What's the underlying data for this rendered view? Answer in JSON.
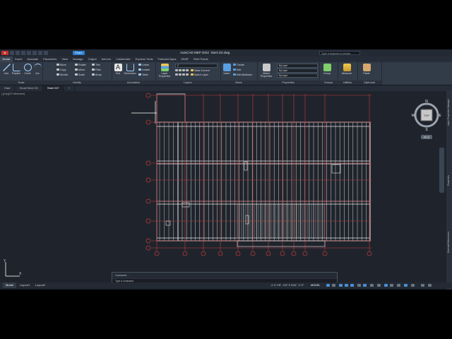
{
  "app": {
    "logo": "A",
    "title": "AutoCAD MEP 2022",
    "file": "Steel 2D.dwg",
    "share": "Share",
    "search_placeholder": "Type a keyword or phrase"
  },
  "ribbon_tabs": [
    "Home",
    "Insert",
    "Annotate",
    "Parametric",
    "View",
    "Manage",
    "Output",
    "Add-ins",
    "Collaborate",
    "Express Tools",
    "Featured Apps",
    "HMI®",
    "Field Points"
  ],
  "ribbon": {
    "draw": {
      "title": "Draw",
      "line": "Line",
      "polyline": "Polyline",
      "circle": "Circle",
      "arc": "Arc"
    },
    "modify": {
      "title": "Modify",
      "move": "Move",
      "rotate": "Rotate",
      "trim": "Trim",
      "copy": "Copy",
      "mirror": "Mirror",
      "fillet": "Fillet",
      "stretch": "Stretch",
      "scale": "Scale",
      "array": "Array"
    },
    "annotation": {
      "title": "Annotation",
      "text": "Text",
      "dimension": "Dimension",
      "linear": "Linear",
      "leader": "Leader",
      "table": "Table"
    },
    "layers": {
      "title": "Layers",
      "layer_properties": "Layer Properties",
      "layer_value": "0",
      "make_current": "Make Current",
      "match_layer": "Match Layer"
    },
    "block": {
      "title": "Block",
      "insert": "Insert",
      "create": "Create",
      "edit": "Edit",
      "edit_attributes": "Edit Attributes"
    },
    "properties": {
      "title": "Properties",
      "match_properties": "Match Properties",
      "bylayer": "ByLayer",
      "bylayer2": "ByLayer",
      "bylayer3": "ByLayer"
    },
    "groups": {
      "title": "Groups",
      "group": "Group"
    },
    "utilities": {
      "title": "Utilities",
      "measure": "Measure"
    },
    "clipboard": {
      "title": "Clipboard",
      "paste": "Paste"
    }
  },
  "file_tabs": [
    "Start",
    "Small Steel 2D",
    "Steel 2D*"
  ],
  "viewport_label": "[-][Top][2D Wireframe]",
  "viewcube": {
    "n": "N",
    "s": "S",
    "e": "E",
    "w": "W",
    "top": "TOP",
    "wcs": "WCS"
  },
  "command": {
    "history": "Command:",
    "placeholder": "Type a command"
  },
  "status": {
    "layouts": [
      "Model",
      "Layout1",
      "Layout2"
    ],
    "coords": "-2'-5 7/8\", 132'-9 9/16\", 0'-0\"",
    "model": "MODEL"
  },
  "ucs": {
    "x": "X",
    "y": "Y"
  },
  "palettes": [
    "Layer Properties Manager",
    "Properties",
    "External References"
  ],
  "colors": {
    "grid_red": "#c43c3c",
    "framing": "#e8e8e8",
    "accent": "#2d7fd1"
  }
}
